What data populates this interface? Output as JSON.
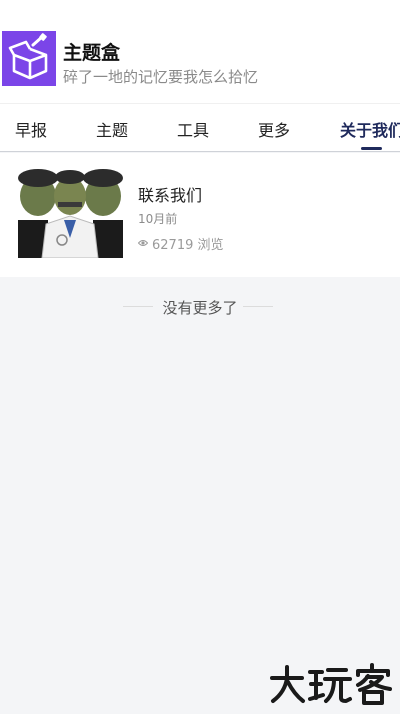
{
  "header": {
    "title": "主题盒",
    "subtitle": "碎了一地的记忆要我怎么拾忆",
    "logo_icon": "box-logo-icon",
    "logo_color": "#7b45e8"
  },
  "tabs": [
    {
      "label": "早报",
      "active": false
    },
    {
      "label": "主题",
      "active": false
    },
    {
      "label": "工具",
      "active": false
    },
    {
      "label": "更多",
      "active": false
    },
    {
      "label": "关于我们",
      "active": true
    }
  ],
  "accent_color": "#1f2a5c",
  "list": {
    "items": [
      {
        "title": "联系我们",
        "time": "10月前",
        "views": "62719 浏览",
        "views_icon": "eye-icon"
      }
    ]
  },
  "footer": {
    "no_more": "没有更多了"
  }
}
